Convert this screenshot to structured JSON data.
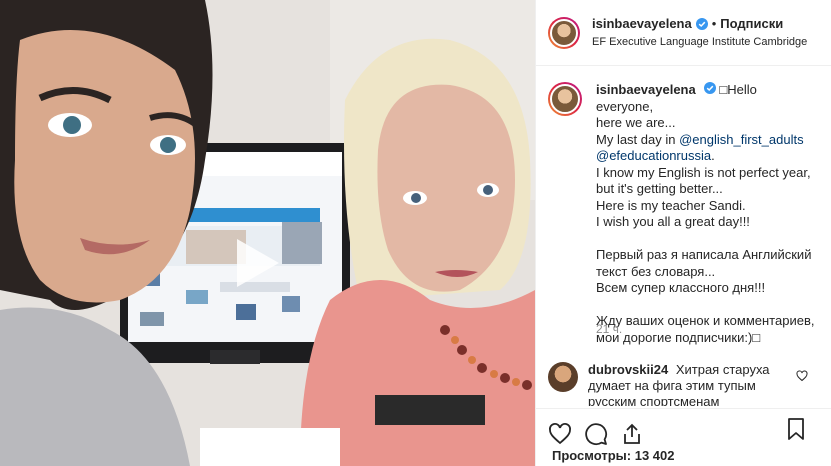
{
  "post": {
    "username": "isinbaevayelena",
    "follow_label": "Подписки",
    "separator": "•",
    "location": "EF Executive Language Institute Cambridge"
  },
  "caption": {
    "username": "isinbaevayelena",
    "lines": [
      "□Hello everyone,",
      "here we are...",
      "My last day in ",
      "@english_first_adults",
      "@efeducationrussia",
      ".",
      "I know my English is not perfect year,",
      "but it's getting better...",
      "Here is my teacher Sandi.",
      "I wish you all a great day!!!",
      "",
      "Первый раз я написала Английский",
      "текст без словаря...",
      "Всем супер классного дня!!!",
      "",
      "Жду ваших оценок и комментариев,",
      "мои дорогие подписчики:)□"
    ],
    "time": "21 ч."
  },
  "comment": {
    "username": "dubrovskii24",
    "text": "Хитрая старуха думает на фига этим тупым русским спортсменам"
  },
  "stats": {
    "views_label": "Просмотры:",
    "views_count": "13 402"
  },
  "colors": {
    "mention": "#00376b",
    "muted": "#8e8e8e",
    "verified": "#3897f0"
  },
  "icons": {
    "like": "heart-icon",
    "comment": "comment-icon",
    "share": "share-icon",
    "save": "bookmark-icon",
    "play": "play-icon"
  }
}
